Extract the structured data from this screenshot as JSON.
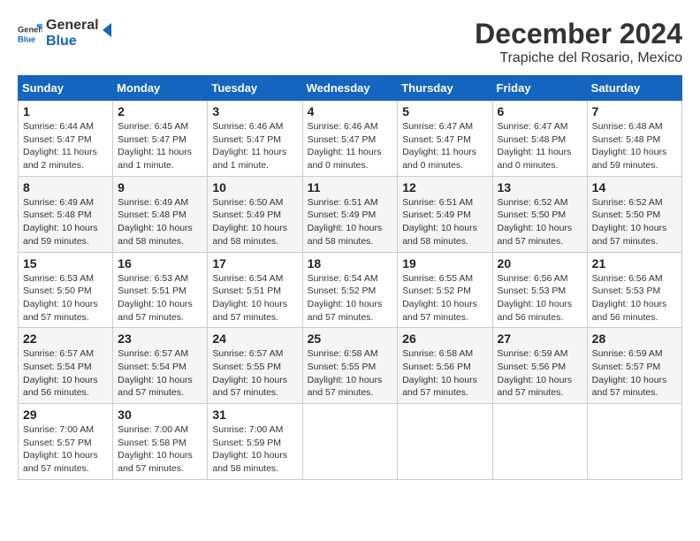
{
  "logo": {
    "line1": "General",
    "line2": "Blue"
  },
  "title": "December 2024",
  "location": "Trapiche del Rosario, Mexico",
  "days_of_week": [
    "Sunday",
    "Monday",
    "Tuesday",
    "Wednesday",
    "Thursday",
    "Friday",
    "Saturday"
  ],
  "weeks": [
    [
      {
        "day": "1",
        "sunrise": "6:44 AM",
        "sunset": "5:47 PM",
        "daylight": "11 hours and 2 minutes."
      },
      {
        "day": "2",
        "sunrise": "6:45 AM",
        "sunset": "5:47 PM",
        "daylight": "11 hours and 1 minute."
      },
      {
        "day": "3",
        "sunrise": "6:46 AM",
        "sunset": "5:47 PM",
        "daylight": "11 hours and 1 minute."
      },
      {
        "day": "4",
        "sunrise": "6:46 AM",
        "sunset": "5:47 PM",
        "daylight": "11 hours and 0 minutes."
      },
      {
        "day": "5",
        "sunrise": "6:47 AM",
        "sunset": "5:47 PM",
        "daylight": "11 hours and 0 minutes."
      },
      {
        "day": "6",
        "sunrise": "6:47 AM",
        "sunset": "5:48 PM",
        "daylight": "11 hours and 0 minutes."
      },
      {
        "day": "7",
        "sunrise": "6:48 AM",
        "sunset": "5:48 PM",
        "daylight": "10 hours and 59 minutes."
      }
    ],
    [
      {
        "day": "8",
        "sunrise": "6:49 AM",
        "sunset": "5:48 PM",
        "daylight": "10 hours and 59 minutes."
      },
      {
        "day": "9",
        "sunrise": "6:49 AM",
        "sunset": "5:48 PM",
        "daylight": "10 hours and 58 minutes."
      },
      {
        "day": "10",
        "sunrise": "6:50 AM",
        "sunset": "5:49 PM",
        "daylight": "10 hours and 58 minutes."
      },
      {
        "day": "11",
        "sunrise": "6:51 AM",
        "sunset": "5:49 PM",
        "daylight": "10 hours and 58 minutes."
      },
      {
        "day": "12",
        "sunrise": "6:51 AM",
        "sunset": "5:49 PM",
        "daylight": "10 hours and 58 minutes."
      },
      {
        "day": "13",
        "sunrise": "6:52 AM",
        "sunset": "5:50 PM",
        "daylight": "10 hours and 57 minutes."
      },
      {
        "day": "14",
        "sunrise": "6:52 AM",
        "sunset": "5:50 PM",
        "daylight": "10 hours and 57 minutes."
      }
    ],
    [
      {
        "day": "15",
        "sunrise": "6:53 AM",
        "sunset": "5:50 PM",
        "daylight": "10 hours and 57 minutes."
      },
      {
        "day": "16",
        "sunrise": "6:53 AM",
        "sunset": "5:51 PM",
        "daylight": "10 hours and 57 minutes."
      },
      {
        "day": "17",
        "sunrise": "6:54 AM",
        "sunset": "5:51 PM",
        "daylight": "10 hours and 57 minutes."
      },
      {
        "day": "18",
        "sunrise": "6:54 AM",
        "sunset": "5:52 PM",
        "daylight": "10 hours and 57 minutes."
      },
      {
        "day": "19",
        "sunrise": "6:55 AM",
        "sunset": "5:52 PM",
        "daylight": "10 hours and 57 minutes."
      },
      {
        "day": "20",
        "sunrise": "6:56 AM",
        "sunset": "5:53 PM",
        "daylight": "10 hours and 56 minutes."
      },
      {
        "day": "21",
        "sunrise": "6:56 AM",
        "sunset": "5:53 PM",
        "daylight": "10 hours and 56 minutes."
      }
    ],
    [
      {
        "day": "22",
        "sunrise": "6:57 AM",
        "sunset": "5:54 PM",
        "daylight": "10 hours and 56 minutes."
      },
      {
        "day": "23",
        "sunrise": "6:57 AM",
        "sunset": "5:54 PM",
        "daylight": "10 hours and 57 minutes."
      },
      {
        "day": "24",
        "sunrise": "6:57 AM",
        "sunset": "5:55 PM",
        "daylight": "10 hours and 57 minutes."
      },
      {
        "day": "25",
        "sunrise": "6:58 AM",
        "sunset": "5:55 PM",
        "daylight": "10 hours and 57 minutes."
      },
      {
        "day": "26",
        "sunrise": "6:58 AM",
        "sunset": "5:56 PM",
        "daylight": "10 hours and 57 minutes."
      },
      {
        "day": "27",
        "sunrise": "6:59 AM",
        "sunset": "5:56 PM",
        "daylight": "10 hours and 57 minutes."
      },
      {
        "day": "28",
        "sunrise": "6:59 AM",
        "sunset": "5:57 PM",
        "daylight": "10 hours and 57 minutes."
      }
    ],
    [
      {
        "day": "29",
        "sunrise": "7:00 AM",
        "sunset": "5:57 PM",
        "daylight": "10 hours and 57 minutes."
      },
      {
        "day": "30",
        "sunrise": "7:00 AM",
        "sunset": "5:58 PM",
        "daylight": "10 hours and 57 minutes."
      },
      {
        "day": "31",
        "sunrise": "7:00 AM",
        "sunset": "5:59 PM",
        "daylight": "10 hours and 58 minutes."
      },
      null,
      null,
      null,
      null
    ]
  ],
  "labels": {
    "sunrise": "Sunrise:",
    "sunset": "Sunset:",
    "daylight": "Daylight hours"
  }
}
